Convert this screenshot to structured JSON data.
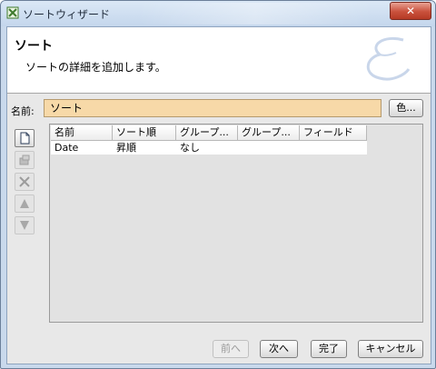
{
  "window": {
    "title": "ソートウィザード",
    "close_label": "✕"
  },
  "header": {
    "title": "ソート",
    "subtitle": "ソートの詳細を追加します。"
  },
  "name_field": {
    "label": "名前:",
    "value": "ソート"
  },
  "color_button": {
    "label": "色..."
  },
  "side_toolbar": [
    {
      "icon": "new-document-icon",
      "enabled": true
    },
    {
      "icon": "properties-icon",
      "enabled": false
    },
    {
      "icon": "delete-icon",
      "enabled": false
    },
    {
      "icon": "move-up-icon",
      "enabled": false
    },
    {
      "icon": "move-down-icon",
      "enabled": false
    }
  ],
  "table": {
    "columns": [
      "名前",
      "ソート順",
      "グループ...",
      "グループ...",
      "フィールド"
    ],
    "rows": [
      [
        "Date",
        "昇順",
        "なし",
        "",
        ""
      ]
    ]
  },
  "footer": {
    "back_label": "前へ",
    "next_label": "次へ",
    "finish_label": "完了",
    "cancel_label": "キャンセル"
  },
  "colors": {
    "name_input_bg": "#f7d9a8",
    "titlebar": "#c9d9ec",
    "close_button": "#c9513c"
  }
}
